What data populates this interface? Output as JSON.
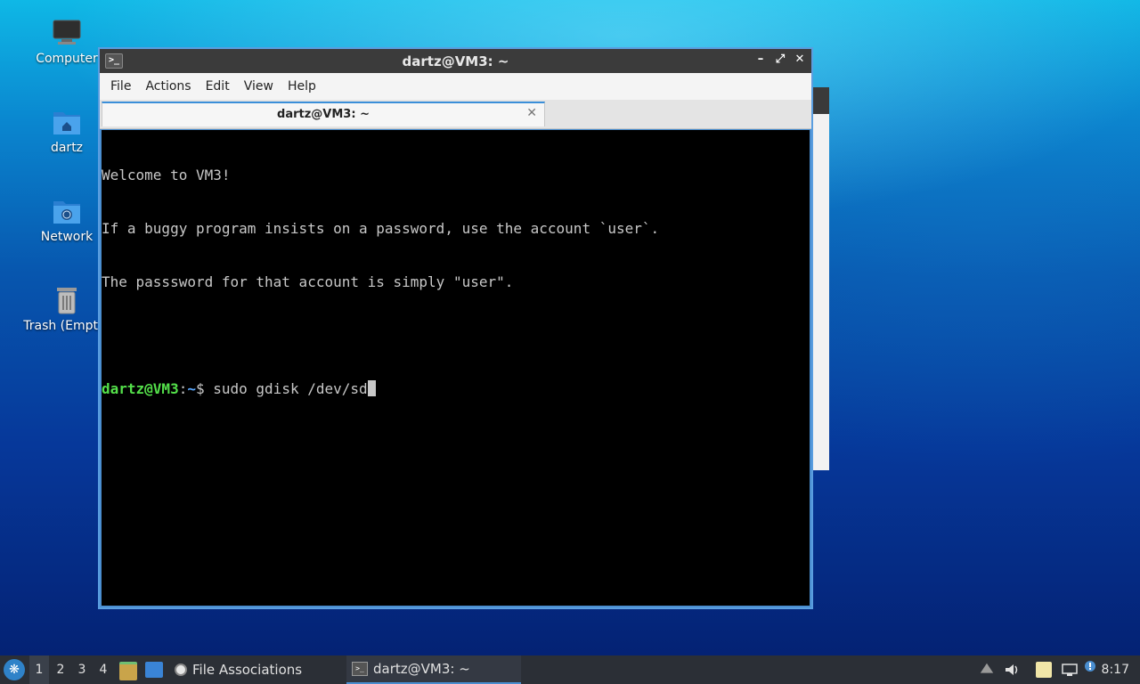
{
  "desktop": {
    "icons": [
      {
        "label": "Computer",
        "icon": "monitor-icon"
      },
      {
        "label": "dartz",
        "icon": "home-folder-icon"
      },
      {
        "label": "Network",
        "icon": "network-folder-icon"
      },
      {
        "label": "Trash (Empty)",
        "icon": "trash-icon"
      }
    ]
  },
  "window": {
    "title": "dartz@VM3: ~",
    "buttons": {
      "minimize": "–",
      "maximize": "⤢",
      "close": "✕"
    },
    "menu": [
      "File",
      "Actions",
      "Edit",
      "View",
      "Help"
    ],
    "tab": {
      "label": "dartz@VM3: ~",
      "close": "✕"
    }
  },
  "terminal": {
    "lines": [
      "Welcome to VM3!",
      "If a buggy program insists on a password, use the account `user`.",
      "The passsword for that account is simply \"user\"."
    ],
    "prompt": {
      "user_host": "dartz@VM3",
      "colon": ":",
      "path": "~",
      "symbol": "$ "
    },
    "command": "sudo gdisk /dev/sd"
  },
  "taskbar": {
    "workspaces": [
      "1",
      "2",
      "3",
      "4"
    ],
    "active_workspace": "1",
    "tasks": [
      {
        "label": "File Associations",
        "icon": "settings-icon"
      },
      {
        "label": "dartz@VM3: ~",
        "icon": "terminal-icon"
      }
    ],
    "clock": "8:17"
  },
  "colors": {
    "prompt_user": "#54e04a",
    "prompt_path": "#5aa8ff",
    "accent": "#4a8ed0"
  }
}
